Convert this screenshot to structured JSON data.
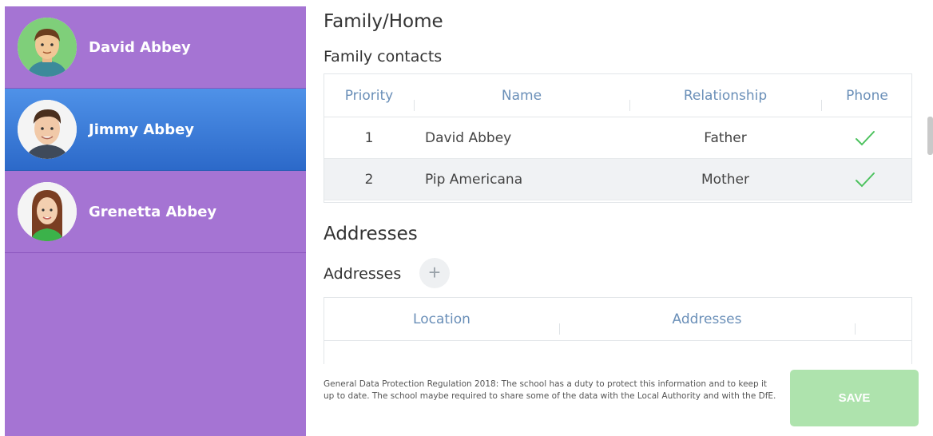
{
  "sidebar": {
    "people": [
      {
        "name": "David Abbey",
        "avatar_icon": "man-avatar-icon"
      },
      {
        "name": "Jimmy Abbey",
        "avatar_icon": "boy-photo-icon"
      },
      {
        "name": "Grenetta Abbey",
        "avatar_icon": "girl-photo-icon"
      }
    ],
    "active_index": 1,
    "colors": {
      "background": "#a574d3",
      "active": "#3a7bd8"
    }
  },
  "main": {
    "section_title": "Family/Home",
    "family_contacts": {
      "title": "Family contacts",
      "columns": [
        "Priority",
        "Name",
        "Relationship",
        "Phone"
      ],
      "rows": [
        {
          "priority": "1",
          "name": "David Abbey",
          "relationship": "Father",
          "phone_icon": "check-icon"
        },
        {
          "priority": "2",
          "name": "Pip Americana",
          "relationship": "Mother",
          "phone_icon": "check-icon"
        }
      ]
    },
    "addresses_section": {
      "title": "Addresses",
      "subtitle": "Addresses",
      "add_icon": "plus-icon",
      "columns": [
        "Location",
        "Addresses"
      ]
    },
    "footer": {
      "gdpr_text": "General Data Protection Regulation 2018: The school has a duty to protect this information and to keep it up to date. The school maybe required to share some of the data with the Local Authority and with the DfE.",
      "save_label": "SAVE",
      "save_color": "#aee3ad"
    }
  }
}
